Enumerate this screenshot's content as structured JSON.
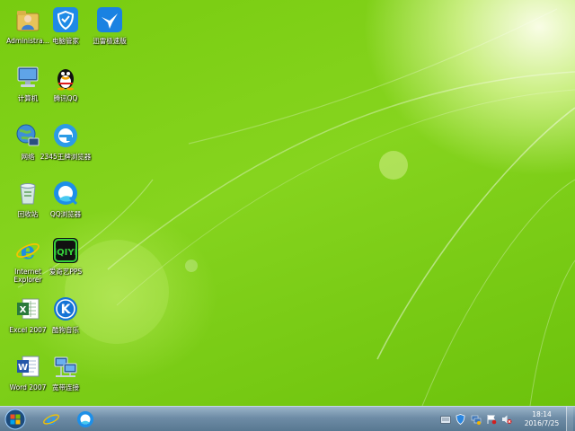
{
  "desktop": {
    "icons": [
      {
        "label": "Administra...",
        "icon": "user-folder-icon"
      },
      {
        "label": "电脑管家",
        "icon": "shield-icon"
      },
      {
        "label": "迅雷极速版",
        "icon": "bird-icon"
      },
      {
        "label": "计算机",
        "icon": "computer-icon"
      },
      {
        "label": "腾讯QQ",
        "icon": "penguin-icon"
      },
      {
        "label": "网络",
        "icon": "network-globe-icon"
      },
      {
        "label": "2345王牌浏览器",
        "icon": "browser-e-icon"
      },
      {
        "label": "回收站",
        "icon": "recycle-bin-icon"
      },
      {
        "label": "QQ浏览器",
        "icon": "qq-browser-icon"
      },
      {
        "label": "Internet Explorer",
        "icon": "ie-icon"
      },
      {
        "label": "爱奇艺PPS",
        "icon": "iqiyi-icon"
      },
      {
        "label": "Excel 2007",
        "icon": "excel-icon"
      },
      {
        "label": "酷狗音乐",
        "icon": "kugou-icon"
      },
      {
        "label": "Word 2007",
        "icon": "word-icon"
      },
      {
        "label": "宽带连接",
        "icon": "broadband-icon"
      }
    ]
  },
  "taskbar": {
    "start": "start-orb-icon",
    "pinned": [
      "ie-icon",
      "qq-browser-icon"
    ],
    "tray_icons": [
      "keyboard-icon",
      "shield-tray-icon",
      "network-tray-icon",
      "flag-icon",
      "volume-muted-icon"
    ],
    "time": "18:14",
    "date": "2016/7/25"
  },
  "colors": {
    "wallpaper": "#7ed320",
    "taskbar": "#6e8ca6"
  }
}
